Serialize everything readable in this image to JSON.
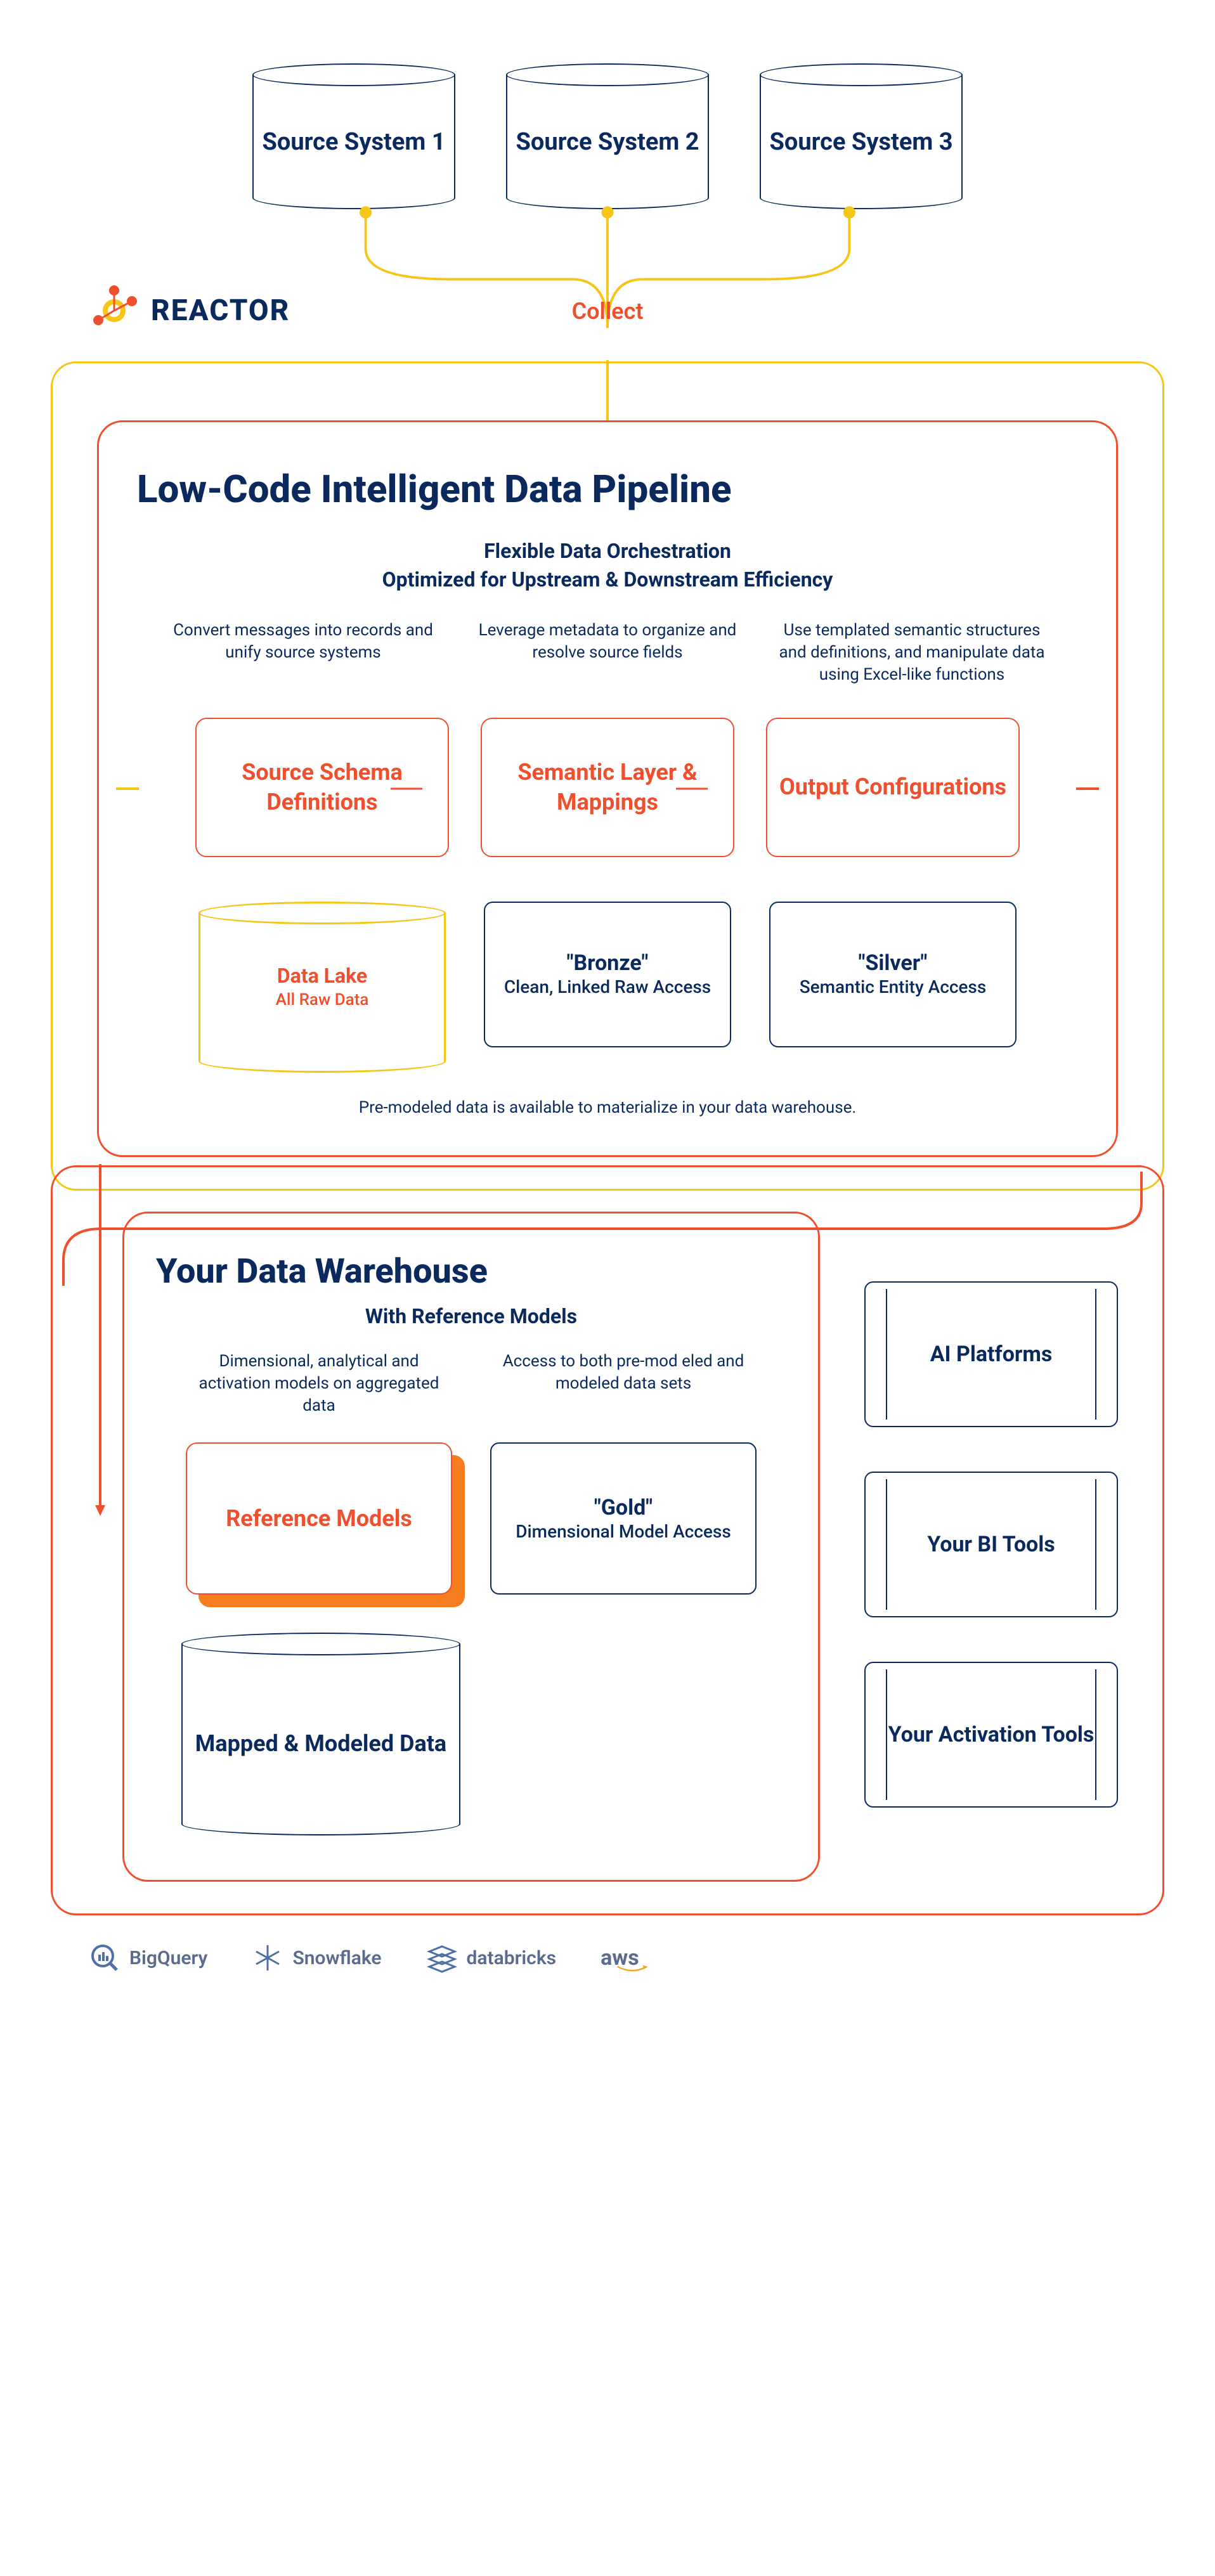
{
  "sources": [
    "Source System 1",
    "Source System 2",
    "Source System 3"
  ],
  "collect_label": "Collect",
  "reactor_brand": "REACTOR",
  "pipeline": {
    "title": "Low-Code Intelligent Data Pipeline",
    "subtitle_line1": "Flexible Data Orchestration",
    "subtitle_line2": "Optimized for Upstream & Downstream Efficiency",
    "descriptions": [
      "Convert messages into records and unify source systems",
      "Leverage metadata to organize and resolve source fields",
      "Use templated semantic structures and definitions, and manipulate data using Excel-like functions"
    ],
    "stage_boxes": [
      "Source Schema Definitions",
      "Semantic Layer & Mappings",
      "Output Configurations"
    ],
    "data_lake": {
      "title": "Data Lake",
      "sub": "All Raw Data"
    },
    "bronze": {
      "title": "\"Bronze\"",
      "sub": "Clean, Linked Raw Access"
    },
    "silver": {
      "title": "\"Silver\"",
      "sub": "Semantic Entity Access"
    },
    "footer": "Pre-modeled data is available to materialize in your data warehouse."
  },
  "warehouse": {
    "title": "Your Data Warehouse",
    "subtitle": "With Reference Models",
    "descriptions": [
      "Dimensional, analytical and activation models on aggregated data",
      "Access to both pre-mod eled and modeled data sets"
    ],
    "reference_models": "Reference Models",
    "gold": {
      "title": "\"Gold\"",
      "sub": "Dimensional Model Access"
    },
    "mapped": "Mapped & Modeled Data"
  },
  "tools": [
    "AI Platforms",
    "Your BI Tools",
    "Your Activation Tools"
  ],
  "bottom_logos": [
    "BigQuery",
    "Snowflake",
    "databricks",
    "aws"
  ]
}
